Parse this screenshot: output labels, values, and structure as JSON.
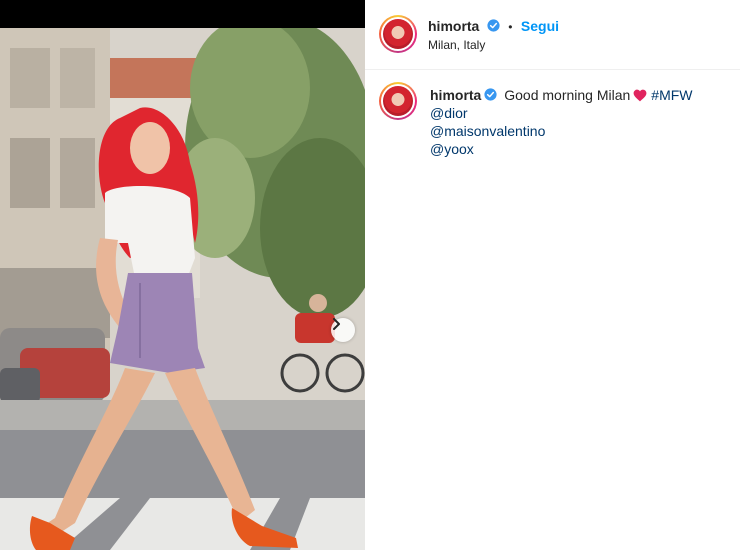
{
  "post": {
    "username": "himorta",
    "follow_label": "Segui",
    "separator": "•",
    "location": "Milan, Italy"
  },
  "caption": {
    "username": "himorta",
    "text": "Good morning Milan",
    "hashtag": "#MFW",
    "mention_1": "@dior",
    "mention_2": "@maisonvalentino",
    "mention_3": "@yoox"
  },
  "icons": {
    "verified": "verified-badge-icon",
    "heart": "red-heart-emoji",
    "next": "chevron-right-icon"
  },
  "colors": {
    "link_blue": "#0095f6",
    "tag_blue": "#00376b",
    "verified_blue": "#3897f0",
    "heart_red": "#e0245e"
  }
}
